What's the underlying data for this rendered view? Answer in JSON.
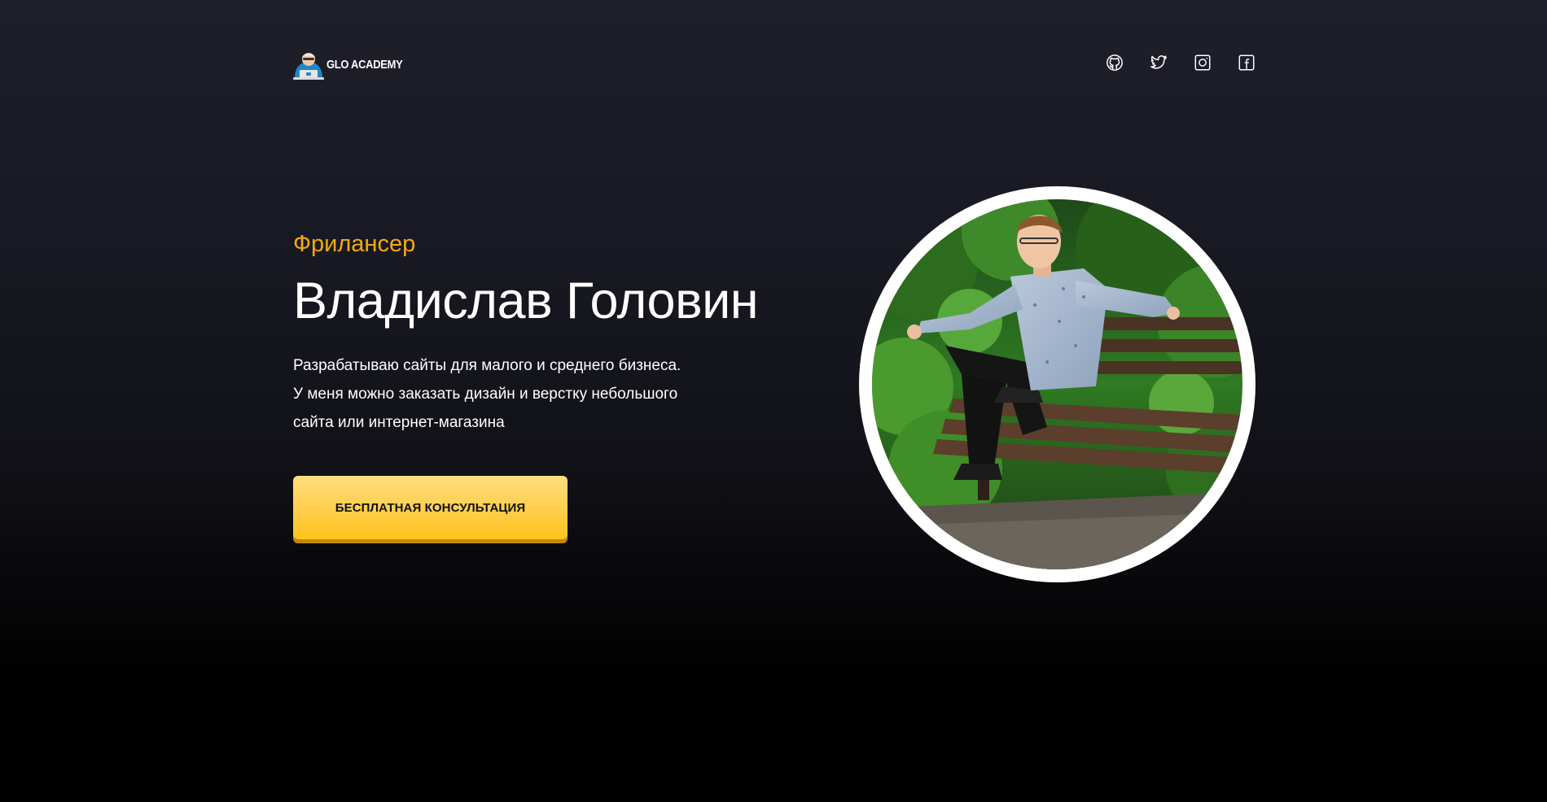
{
  "header": {
    "logo_text": "GLO ACADEMY",
    "socials": [
      {
        "name": "github",
        "icon": "github-icon"
      },
      {
        "name": "twitter",
        "icon": "twitter-icon"
      },
      {
        "name": "instagram",
        "icon": "instagram-icon"
      },
      {
        "name": "facebook",
        "icon": "facebook-icon"
      }
    ]
  },
  "hero": {
    "subtitle": "Фрилансер",
    "title": "Владислав Головин",
    "description_lines": [
      "Разрабатываю сайты для малого и среднего бизнеса.",
      "У меня можно заказать дизайн и верстку небольшого",
      "сайта или интернет-магазина"
    ],
    "cta_label": "БЕСПЛАТНАЯ КОНСУЛЬТАЦИЯ"
  },
  "photo": {
    "subject": "portrait-photo"
  },
  "colors": {
    "accent": "#f5a90f",
    "button_top": "#ffde7e",
    "button_bottom": "#ffc31b",
    "button_shadow": "#c58807",
    "background_top": "#1f1f2b",
    "background_bottom": "#000000",
    "text": "#ffffff"
  }
}
